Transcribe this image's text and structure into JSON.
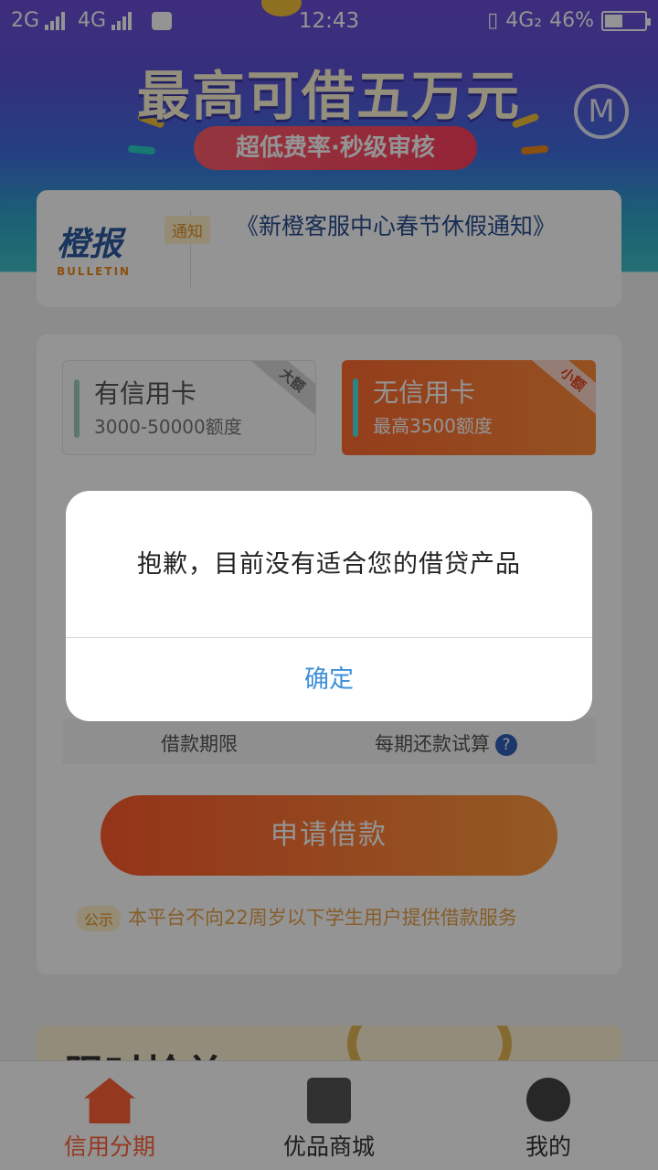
{
  "status_bar": {
    "carrier1": "2G",
    "carrier2": "4G",
    "time": "12:43",
    "network": "4G₂",
    "battery": "46%",
    "battery_level": 0.46
  },
  "hero": {
    "title": "最高可借五万元",
    "subtitle": "超低费率·秒级审核",
    "logo_icon": "m-logo-icon"
  },
  "bulletin": {
    "logo_cn": "橙报",
    "logo_en": "BULLETIN",
    "tag": "通知",
    "text": "《新橙客服中心春节休假通知》"
  },
  "loan_options": [
    {
      "title": "有信用卡",
      "subtitle": "3000-50000额度",
      "corner": "大额",
      "selected": false
    },
    {
      "title": "无信用卡",
      "subtitle": "最高3500额度",
      "corner": "小额",
      "selected": true
    }
  ],
  "loan_form": {
    "term_label": "借款期限",
    "repay_label": "每期还款试算",
    "help_icon": "?"
  },
  "apply_button": "申请借款",
  "notice": {
    "tag": "公示",
    "text": "本平台不向22周岁以下学生用户提供借款服务"
  },
  "promo": {
    "text": "限时抢单"
  },
  "tabs": [
    {
      "label": "信用分期",
      "icon": "home-icon",
      "active": true
    },
    {
      "label": "优品商城",
      "icon": "shopping-bag-icon",
      "active": false
    },
    {
      "label": "我的",
      "icon": "profile-icon",
      "active": false
    }
  ],
  "dialog": {
    "message": "抱歉，目前没有适合您的借贷产品",
    "confirm": "确定"
  },
  "colors": {
    "accent": "#ff6138",
    "dialog_button": "#3f8fd9"
  }
}
